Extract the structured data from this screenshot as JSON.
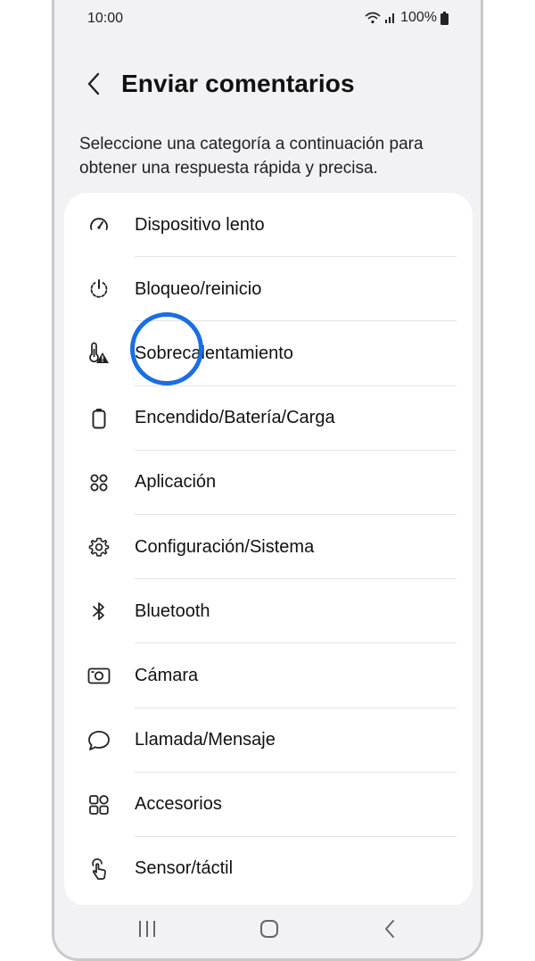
{
  "status_bar": {
    "time": "10:00",
    "battery": "100%"
  },
  "header": {
    "title": "Enviar comentarios"
  },
  "description": "Seleccione una categoría a continuación para obtener una respuesta rápida y precisa.",
  "categories": [
    {
      "label": "Dispositivo lento",
      "icon": "speedometer-icon"
    },
    {
      "label": "Bloqueo/reinicio",
      "icon": "power-restart-icon"
    },
    {
      "label": "Sobrecalentamiento",
      "icon": "thermometer-warning-icon"
    },
    {
      "label": "Encendido/Batería/Carga",
      "icon": "battery-icon"
    },
    {
      "label": "Aplicación",
      "icon": "apps-icon"
    },
    {
      "label": "Configuración/Sistema",
      "icon": "gear-icon"
    },
    {
      "label": "Bluetooth",
      "icon": "bluetooth-icon"
    },
    {
      "label": "Cámara",
      "icon": "camera-icon"
    },
    {
      "label": "Llamada/Mensaje",
      "icon": "chat-bubble-icon"
    },
    {
      "label": "Accesorios",
      "icon": "accessories-icon"
    },
    {
      "label": "Sensor/táctil",
      "icon": "touch-icon"
    }
  ],
  "colors": {
    "accent_ring": "#1a6fe0",
    "background": "#f2f2f4",
    "card": "#ffffff"
  }
}
